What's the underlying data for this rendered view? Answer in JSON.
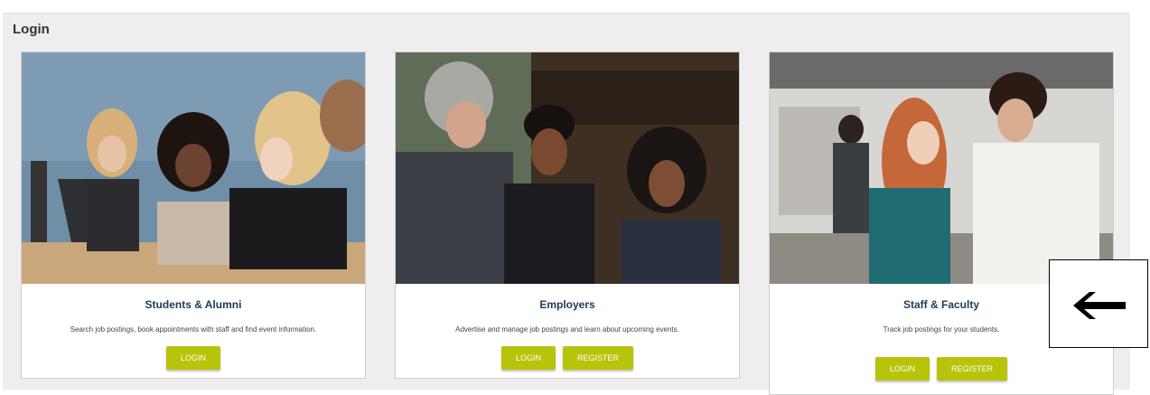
{
  "page": {
    "title": "Login"
  },
  "cards": [
    {
      "title": "Students & Alumni",
      "description": "Search job postings, book appointments with staff and find event information.",
      "buttons": {
        "login": "LOGIN"
      }
    },
    {
      "title": "Employers",
      "description": "Advertise and manage job postings and learn about upcoming events.",
      "buttons": {
        "login": "LOGIN",
        "register": "REGISTER"
      }
    },
    {
      "title": "Staff & Faculty",
      "description": "Track job postings for your students.",
      "buttons": {
        "login": "LOGIN",
        "register": "REGISTER"
      }
    }
  ],
  "overlay": {
    "icon": "left-arrow-icon"
  },
  "colors": {
    "accent_button": "#b7c40a",
    "card_title": "#1d3b5a",
    "panel_background": "#efedf0"
  }
}
